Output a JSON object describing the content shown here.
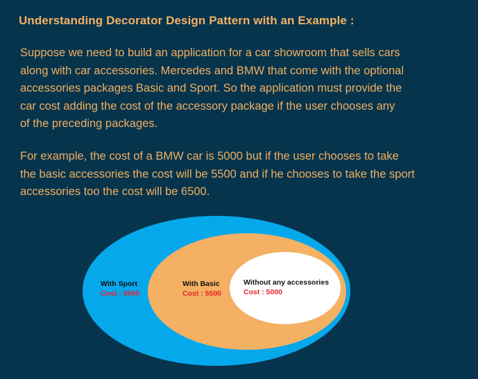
{
  "heading": "Understanding Decorator Design Pattern with an Example :",
  "paragraphs": [
    {
      "lines": [
        "Suppose we need to build an application for a car showroom that sells cars",
        "along with car accessories. Mercedes and BMW  that come with the optional",
        "accessories packages Basic and Sport. So the application must provide the",
        "car cost adding the cost of the accessory package if the user chooses any",
        "of the preceding packages."
      ]
    },
    {
      "lines": [
        "For example, the cost of a BMW car is 5000 but if the user chooses to take",
        "the basic accessories the cost will be 5500 and if he chooses to take the sport",
        "accessories too the cost will be 6500."
      ]
    }
  ],
  "diagram": {
    "outer": {
      "title": "With Sport",
      "cost": "Cost : 6500",
      "color": "#06a8ec"
    },
    "middle": {
      "title": "With Basic",
      "cost": "Cost : 5500",
      "color": "#f4b063"
    },
    "inner": {
      "title": "Without any accessories",
      "cost": "Cost : 5000",
      "color": "#ffffff"
    },
    "cost_color": "#e8232a"
  },
  "colors": {
    "background": "#06344d",
    "text": "#f2ae60"
  }
}
